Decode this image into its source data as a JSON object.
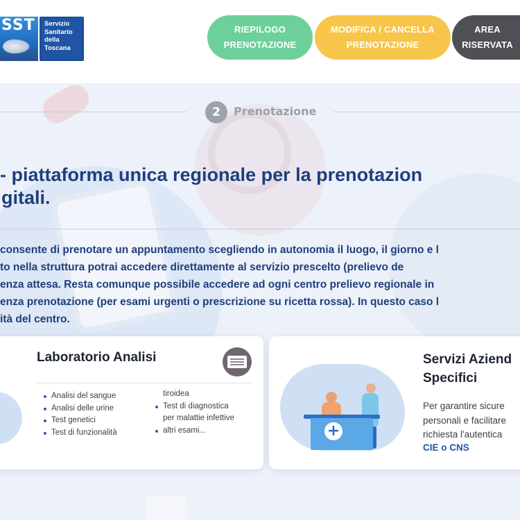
{
  "header": {
    "logo": {
      "mark_text": "SST",
      "org_lines": [
        "Servizio",
        "Sanitario",
        "della",
        "Toscana"
      ]
    },
    "nav": [
      {
        "line1": "RIEPILOGO",
        "line2": "PRENOTAZIONE",
        "color": "#6dd09a"
      },
      {
        "line1": "MODIFICA / CANCELLA",
        "line2": "PRENOTAZIONE",
        "color": "#f7c54a"
      },
      {
        "line1": "AREA",
        "line2": "RISERVATA",
        "color": "#4f4f55"
      }
    ]
  },
  "stepper": {
    "number": "2",
    "label": "Prenotazione"
  },
  "hero": {
    "title_lines": [
      "- piattaforma unica regionale per la prenotazion",
      "gitali."
    ],
    "body_lines": [
      "consente di prenotare un appuntamento scegliendo in autonomia il luogo, il giorno e l",
      "to nella struttura potrai accedere direttamente al servizio prescelto (prelievo de",
      "enza attesa. Resta comunque possibile accedere ad ogni centro prelievo regionale in",
      "enza prenotazione (per esami urgenti o prescrizione su ricetta rossa). In questo caso l",
      "ità del centro."
    ]
  },
  "cards": {
    "lab": {
      "title": "Laboratorio Analisi",
      "icon": "document-card-icon",
      "list_col1": [
        "Analisi del sangue",
        "Analisi delle urine",
        "Test genetici",
        "Test di funzionalità"
      ],
      "list_col2": [
        "tiroidea",
        "Test di diagnostica",
        "per malattie infettive",
        "altri esami..."
      ]
    },
    "services": {
      "title_lines": [
        "Servizi Aziend",
        "Specifici"
      ],
      "text_lines": [
        "Per garantire sicure",
        "personali e facilitare",
        "richiesta  l'autentica"
      ],
      "link": "CIE o CNS"
    }
  },
  "colors": {
    "primary_text": "#1e3f7c",
    "background": "#e8eef8",
    "link": "#2355a8"
  }
}
